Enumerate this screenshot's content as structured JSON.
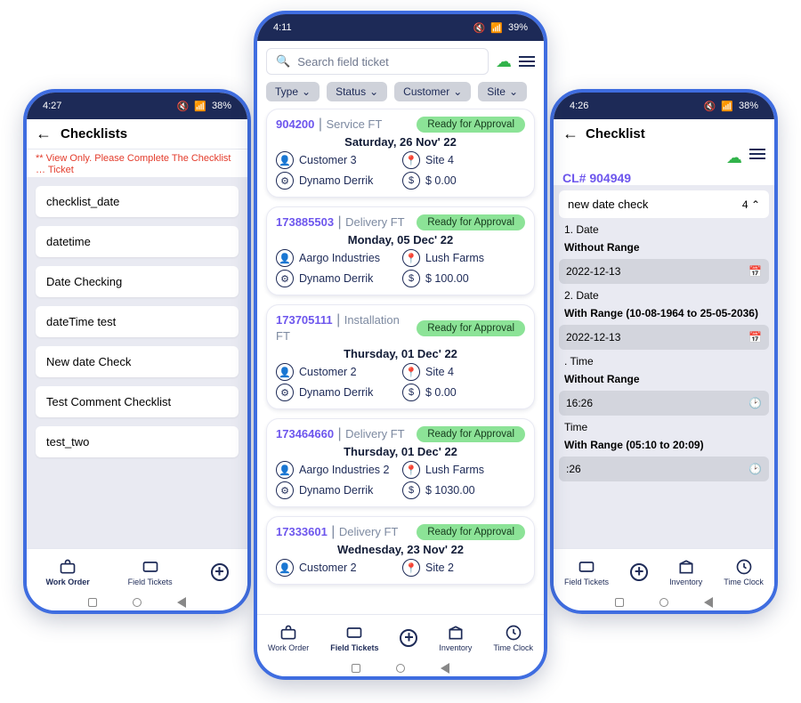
{
  "phone_left": {
    "status": {
      "time": "4:27",
      "battery": "38%"
    },
    "header_title": "Checklists",
    "warning": "** View Only. Please Complete The Checklist … Ticket",
    "items": [
      "checklist_date",
      "datetime",
      "Date Checking",
      "dateTime test",
      "New date Check",
      "Test Comment Checklist",
      "test_two"
    ],
    "nav": {
      "work_order": "Work Order",
      "field_tickets": "Field Tickets"
    }
  },
  "phone_mid": {
    "status": {
      "time": "4:11",
      "battery": "39%"
    },
    "search_placeholder": "Search field ticket",
    "filters": {
      "type": "Type",
      "status": "Status",
      "customer": "Customer",
      "site": "Site"
    },
    "tickets": [
      {
        "id": "904200",
        "type": "Service FT",
        "status": "Ready for Approval",
        "date": "Saturday, 26 Nov' 22",
        "customer": "Customer 3",
        "site": "Site 4",
        "equipment": "Dynamo Derrik",
        "amount": "$ 0.00"
      },
      {
        "id": "173885503",
        "type": "Delivery FT",
        "status": "Ready for Approval",
        "date": "Monday, 05 Dec' 22",
        "customer": "Aargo Industries",
        "site": "Lush Farms",
        "equipment": "Dynamo Derrik",
        "amount": "$ 100.00"
      },
      {
        "id": "173705111",
        "type": "Installation FT",
        "status": "Ready for Approval",
        "date": "Thursday, 01 Dec' 22",
        "customer": "Customer 2",
        "site": "Site 4",
        "equipment": "Dynamo Derrik",
        "amount": "$ 0.00"
      },
      {
        "id": "173464660",
        "type": "Delivery FT",
        "status": "Ready for Approval",
        "date": "Thursday, 01 Dec' 22",
        "customer": "Aargo Industries 2",
        "site": "Lush Farms",
        "equipment": "Dynamo Derrik",
        "amount": "$ 1030.00"
      },
      {
        "id": "17333601",
        "type": "Delivery FT",
        "status": "Ready for Approval",
        "date": "Wednesday, 23 Nov' 22",
        "customer": "Customer 2",
        "site": "Site 2",
        "equipment": "",
        "amount": ""
      }
    ],
    "nav": {
      "work_order": "Work Order",
      "field_tickets": "Field Tickets",
      "inventory": "Inventory",
      "time_clock": "Time Clock"
    }
  },
  "phone_right": {
    "status": {
      "time": "4:26",
      "battery": "38%"
    },
    "header_title": "Checklist",
    "cl_id": "CL# 904949",
    "section_title": "new date check",
    "section_count": "4",
    "fields": [
      {
        "q": "1. Date",
        "sub": "Without Range",
        "value": "2022-12-13",
        "icon": "calendar"
      },
      {
        "q": "2. Date",
        "sub": "With Range (10-08-1964 to 25-05-2036)",
        "value": "2022-12-13",
        "icon": "calendar"
      },
      {
        "q": ". Time",
        "sub": "Without Range",
        "value": "16:26",
        "icon": "clock"
      },
      {
        "q": "Time",
        "sub": "With Range (05:10 to 20:09)",
        "value": ":26",
        "icon": "clock"
      }
    ],
    "nav": {
      "field_tickets": "Field Tickets",
      "inventory": "Inventory",
      "time_clock": "Time Clock"
    }
  }
}
